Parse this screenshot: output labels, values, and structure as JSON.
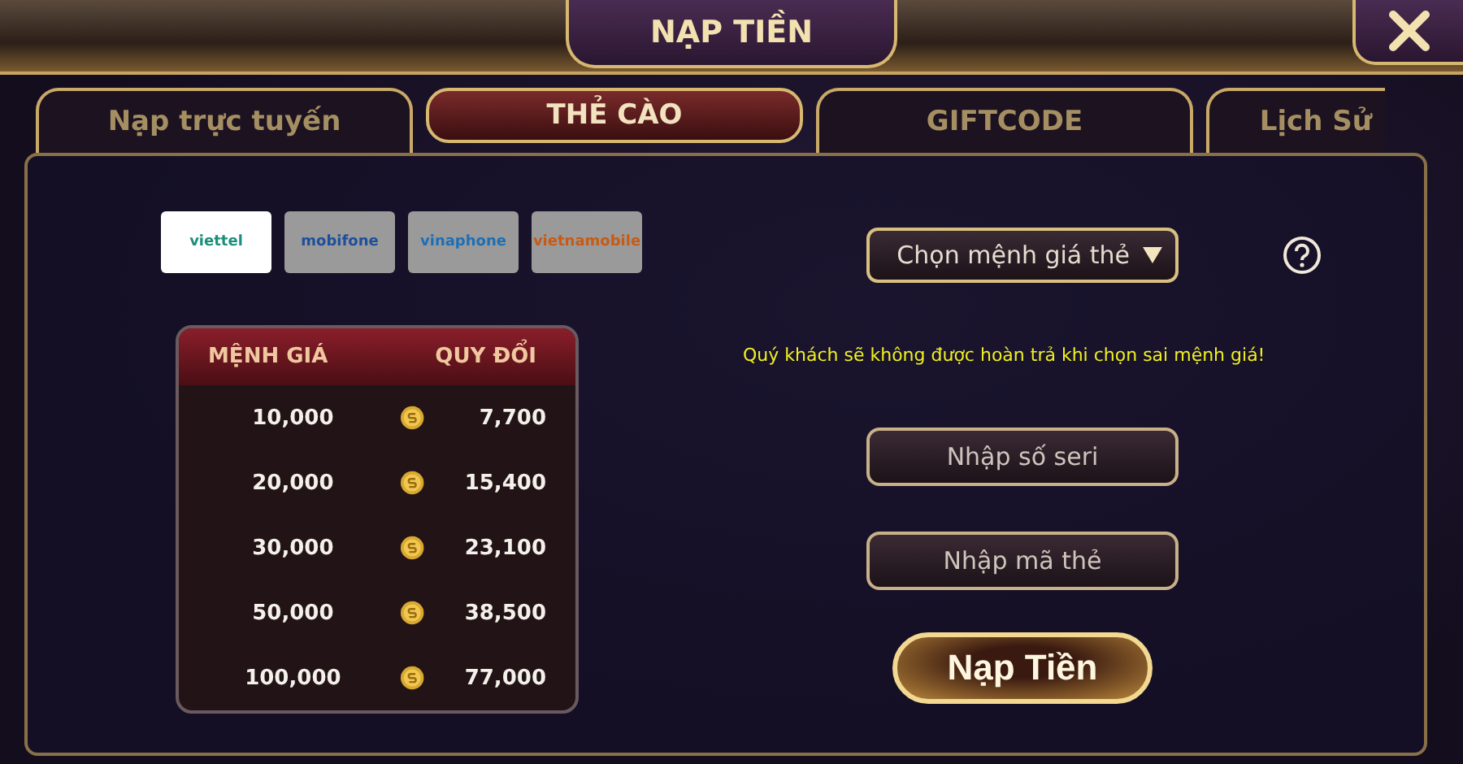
{
  "window": {
    "title": "NẠP TIỀN"
  },
  "tabs": [
    {
      "label": "Nạp trực tuyến",
      "selected": false
    },
    {
      "label": "THẺ CÀO",
      "selected": true
    },
    {
      "label": "GIFTCODE",
      "selected": false
    },
    {
      "label": "Lịch Sử",
      "selected": false
    }
  ],
  "carriers": [
    {
      "name": "viettel",
      "selected": true
    },
    {
      "name": "mobifone",
      "selected": false
    },
    {
      "name": "vinaphone",
      "selected": false
    },
    {
      "name": "vietnamobile",
      "selected": false
    }
  ],
  "rate_table": {
    "columns": [
      "MỆNH GIÁ",
      "QUY ĐỔI"
    ],
    "rows": [
      {
        "value": "10,000",
        "reward": "7,700"
      },
      {
        "value": "20,000",
        "reward": "15,400"
      },
      {
        "value": "30,000",
        "reward": "23,100"
      },
      {
        "value": "50,000",
        "reward": "38,500"
      },
      {
        "value": "100,000",
        "reward": "77,000"
      }
    ]
  },
  "denomination_select": {
    "placeholder": "Chọn mệnh giá thẻ"
  },
  "warning": "Quý khách sẽ không được hoàn trả khi chọn sai mệnh giá!",
  "serial_field": {
    "placeholder": "Nhập số seri"
  },
  "code_field": {
    "placeholder": "Nhập mã thẻ"
  },
  "submit_button": "Nạp Tiền"
}
